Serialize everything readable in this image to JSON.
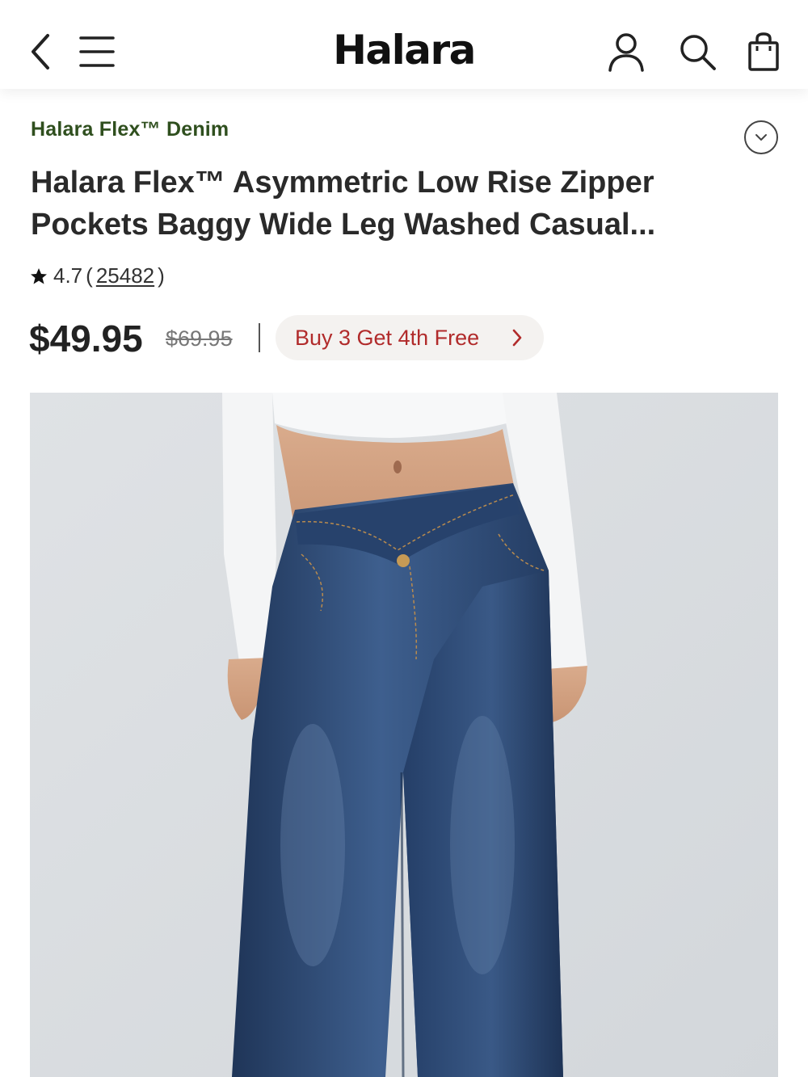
{
  "header": {
    "logo": "Halara",
    "back_icon": "chevron-left-icon",
    "menu_icon": "hamburger-menu-icon",
    "account_icon": "user-icon",
    "search_icon": "search-icon",
    "bag_icon": "shopping-bag-icon"
  },
  "product": {
    "collection": "Halara Flex™ Denim",
    "title": "Halara Flex™ Asymmetric Low Rise Zipper Pockets Baggy Wide Leg Washed Casual...",
    "rating": "4.7",
    "review_open": "(",
    "review_count": "25482",
    "review_close": ")",
    "price": "$49.95",
    "original_price": "$69.95",
    "promo_label": "Buy 3 Get 4th Free",
    "image_alt": "Model wearing dark wash low rise wide leg jeans with a white cropped long-sleeve top"
  },
  "colors": {
    "collection": "#2f4f1e",
    "promo_text": "#b12b2b",
    "promo_bg": "#f4f2f0",
    "denim": "#2c4a76"
  }
}
